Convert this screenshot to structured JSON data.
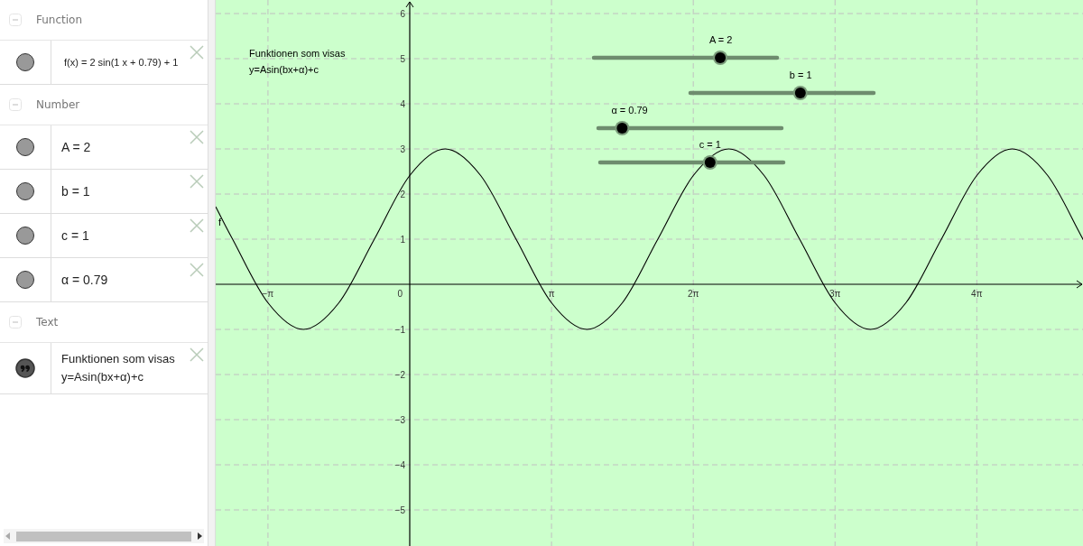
{
  "algebra_view": {
    "sections": [
      {
        "title": "Function",
        "expanded": true,
        "items": [
          {
            "kind": "object",
            "shown": true,
            "lines": [
              "f(x) = 2 sin(1 x + 0.79) + 1"
            ]
          }
        ]
      },
      {
        "title": "Number",
        "expanded": true,
        "items": [
          {
            "kind": "object",
            "shown": true,
            "lines": [
              "A = 2"
            ]
          },
          {
            "kind": "object",
            "shown": true,
            "lines": [
              "b = 1"
            ]
          },
          {
            "kind": "object",
            "shown": true,
            "lines": [
              "c = 1"
            ]
          },
          {
            "kind": "object",
            "shown": true,
            "lines": [
              "α = 0.79"
            ]
          }
        ]
      },
      {
        "title": "Text",
        "expanded": true,
        "items": [
          {
            "kind": "text",
            "shown": true,
            "lines": [
              "Funktionen som visas",
              "y=Asin(bx+α)+c"
            ]
          }
        ]
      }
    ]
  },
  "graphics_view": {
    "text_lines": [
      "Funktionen som visas",
      "y=Asin(bx+α)+c"
    ],
    "origin_label": "0",
    "sliders": [
      {
        "label": "A = 2",
        "level": 0.69
      },
      {
        "label": "b = 1",
        "level": 0.6
      },
      {
        "label": "α = 0.79",
        "level": 0.13
      },
      {
        "label": "c = 1",
        "level": 0.6
      }
    ],
    "chart_data": {
      "type": "line",
      "x": [
        -4.3,
        -3.927,
        -3.142,
        -2.356,
        -1.571,
        -0.785,
        0,
        0.785,
        1.571,
        2.356,
        3.142,
        3.927,
        4.712,
        5.498,
        6.283,
        7.069,
        7.854,
        8.639,
        9.425,
        10.21,
        10.996,
        11.781,
        12.566,
        13.352,
        14.137,
        14.94
      ],
      "series": [
        {
          "name": "f",
          "color": "#000000",
          "values": [
            1.72,
            1,
            -0.41,
            -1,
            -0.41,
            1,
            2.41,
            3,
            2.41,
            1,
            -0.41,
            -1,
            -0.41,
            1,
            2.41,
            3,
            2.41,
            1,
            -0.41,
            -1,
            -0.41,
            1,
            2.41,
            3,
            2.41,
            0.96
          ]
        }
      ],
      "xlim": [
        -4.3,
        14.94
      ],
      "grid": true,
      "ylim": [
        -5.8,
        6.3
      ],
      "xticks": [
        {
          "value": -3.1416,
          "label": "−π"
        },
        {
          "value": 3.1416,
          "label": "π"
        },
        {
          "value": 6.2832,
          "label": "2π"
        },
        {
          "value": 9.4248,
          "label": "3π"
        },
        {
          "value": 12.5664,
          "label": "4π"
        }
      ],
      "yticks": [
        {
          "value": -5,
          "label": "−5"
        },
        {
          "value": -4,
          "label": "−4"
        },
        {
          "value": -3,
          "label": "−3"
        },
        {
          "value": -2,
          "label": "−2"
        },
        {
          "value": -1,
          "label": "−1"
        },
        {
          "value": 1,
          "label": "1"
        },
        {
          "value": 2,
          "label": "2"
        },
        {
          "value": 3,
          "label": "3"
        },
        {
          "value": 4,
          "label": "4"
        },
        {
          "value": 5,
          "label": "5"
        },
        {
          "value": 6,
          "label": "6"
        }
      ]
    }
  }
}
